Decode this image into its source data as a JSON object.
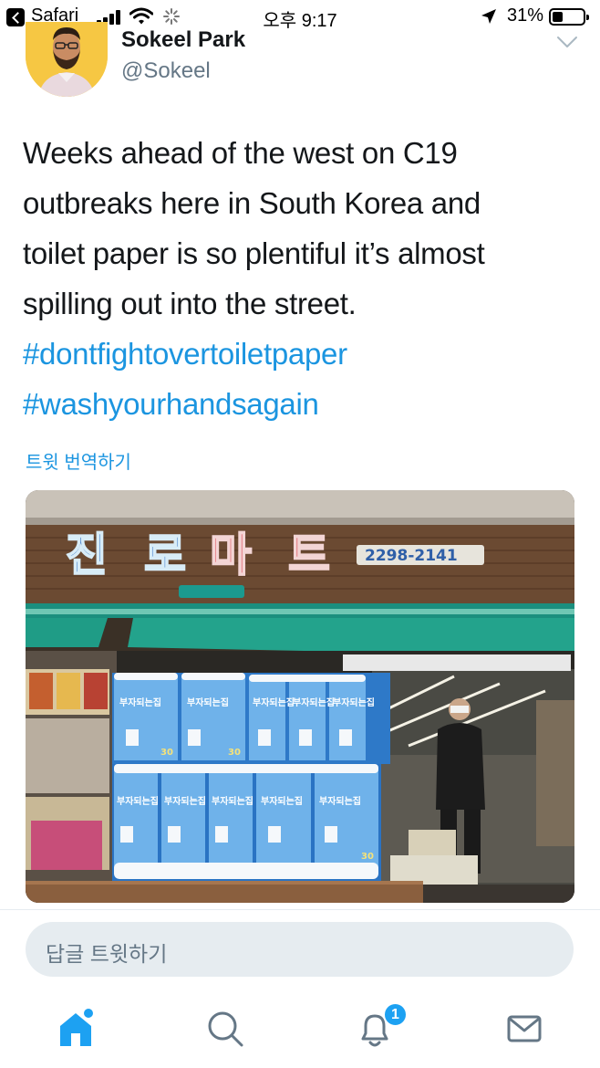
{
  "status_bar": {
    "back_app": "Safari",
    "time": "오후 9:17",
    "battery": "31%",
    "icons": [
      "back-icon",
      "signal-icon",
      "wifi-icon",
      "loading-icon",
      "location-icon",
      "battery-icon"
    ]
  },
  "tweet": {
    "author_name": "Sokeel Park",
    "author_handle": "@Sokeel",
    "text_lines": [
      "Weeks ahead of the west on C19",
      "outbreaks here in South Korea and",
      "toilet paper is so plentiful it’s almost",
      "spilling out into the street."
    ],
    "hashtags": [
      "#dontfightovertoiletpaper",
      "#washyourhandsagain"
    ],
    "translate_label": "트윗 번역하기"
  },
  "photo": {
    "store_sign_letters": [
      "진",
      "로",
      "마",
      "트"
    ],
    "sign_phone": "2298-2141",
    "package_brand": "부자되는집",
    "package_count": "30"
  },
  "reply": {
    "placeholder": "답글 트윗하기"
  },
  "nav": {
    "items": [
      "home-icon",
      "search-icon",
      "notifications-icon",
      "messages-icon"
    ],
    "notification_count": "1"
  },
  "colors": {
    "accent": "#1b95e0",
    "text": "#14171a",
    "secondary": "#657786",
    "reply_bg": "#e6ecf0"
  }
}
